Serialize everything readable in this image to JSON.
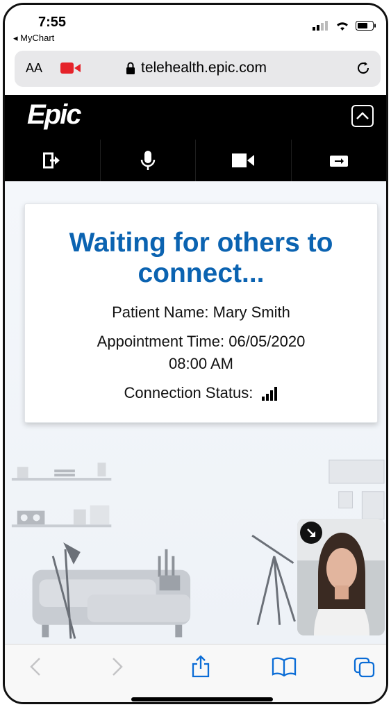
{
  "status_bar": {
    "time": "7:55",
    "back_app": "◂ MyChart"
  },
  "browser": {
    "text_size_label": "AA",
    "url": "telehealth.epic.com"
  },
  "epic": {
    "logo": "Epic"
  },
  "waiting": {
    "title": "Waiting for others to connect...",
    "patient": "Patient Name: Mary Smith",
    "appointment_line1": "Appointment Time: 06/05/2020",
    "appointment_line2": "08:00  AM",
    "connection": "Connection Status:"
  },
  "colors": {
    "title_blue": "#0b63b1",
    "camera_red": "#e5232a"
  },
  "icons": [
    "leave-icon",
    "microphone-icon",
    "video-camera-icon",
    "switch-camera-icon",
    "collapse-icon",
    "back-icon",
    "forward-icon",
    "share-icon",
    "bookmarks-icon",
    "tabs-icon"
  ]
}
